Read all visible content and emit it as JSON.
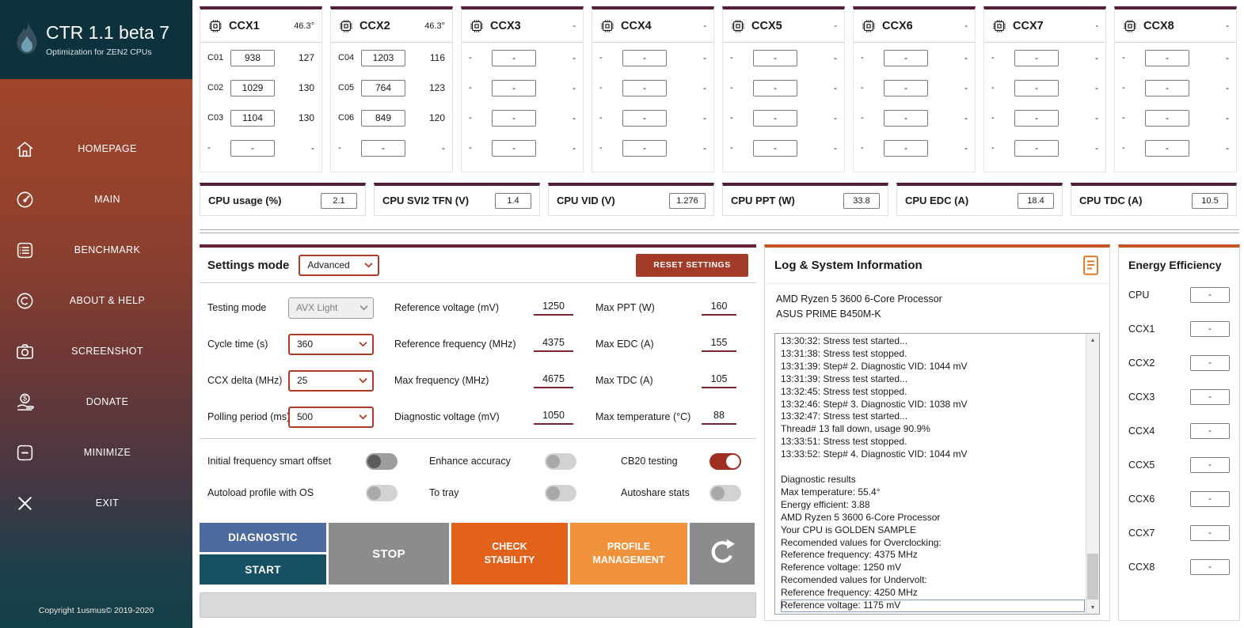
{
  "sidebar": {
    "title": "CTR 1.1 beta 7",
    "subtitle": "Optimization for ZEN2 CPUs",
    "items": [
      {
        "id": "homepage",
        "label": "HOMEPAGE",
        "icon": "home-icon"
      },
      {
        "id": "main",
        "label": "MAIN",
        "icon": "gauge-icon"
      },
      {
        "id": "benchmark",
        "label": "BENCHMARK",
        "icon": "benchmark-icon"
      },
      {
        "id": "about-help",
        "label": "ABOUT & HELP",
        "icon": "copyright-icon"
      },
      {
        "id": "screenshot",
        "label": "SCREENSHOT",
        "icon": "camera-icon"
      },
      {
        "id": "donate",
        "label": "DONATE",
        "icon": "donate-icon"
      },
      {
        "id": "minimize",
        "label": "MINIMIZE",
        "icon": "minimize-icon"
      },
      {
        "id": "exit",
        "label": "EXIT",
        "icon": "exit-icon"
      }
    ],
    "copyright": "Copyright 1usmus© 2019-2020"
  },
  "ccx_panels": [
    {
      "title": "CCX1",
      "temp": "46.3°",
      "rows": [
        {
          "core": "C01",
          "value": "938",
          "metric": "127"
        },
        {
          "core": "C02",
          "value": "1029",
          "metric": "130"
        },
        {
          "core": "C03",
          "value": "1104",
          "metric": "130"
        },
        {
          "core": "-",
          "value": "-",
          "metric": "-"
        }
      ]
    },
    {
      "title": "CCX2",
      "temp": "46.3°",
      "rows": [
        {
          "core": "C04",
          "value": "1203",
          "metric": "116"
        },
        {
          "core": "C05",
          "value": "764",
          "metric": "123"
        },
        {
          "core": "C06",
          "value": "849",
          "metric": "120"
        },
        {
          "core": "-",
          "value": "-",
          "metric": "-"
        }
      ]
    },
    {
      "title": "CCX3",
      "temp": "-",
      "rows": [
        {
          "core": "-",
          "value": "-",
          "metric": "-"
        },
        {
          "core": "-",
          "value": "-",
          "metric": "-"
        },
        {
          "core": "-",
          "value": "-",
          "metric": "-"
        },
        {
          "core": "-",
          "value": "-",
          "metric": "-"
        }
      ]
    },
    {
      "title": "CCX4",
      "temp": "-",
      "rows": [
        {
          "core": "-",
          "value": "-",
          "metric": "-"
        },
        {
          "core": "-",
          "value": "-",
          "metric": "-"
        },
        {
          "core": "-",
          "value": "-",
          "metric": "-"
        },
        {
          "core": "-",
          "value": "-",
          "metric": "-"
        }
      ]
    },
    {
      "title": "CCX5",
      "temp": "-",
      "rows": [
        {
          "core": "-",
          "value": "-",
          "metric": "-"
        },
        {
          "core": "-",
          "value": "-",
          "metric": "-"
        },
        {
          "core": "-",
          "value": "-",
          "metric": "-"
        },
        {
          "core": "-",
          "value": "-",
          "metric": "-"
        }
      ]
    },
    {
      "title": "CCX6",
      "temp": "-",
      "rows": [
        {
          "core": "-",
          "value": "-",
          "metric": "-"
        },
        {
          "core": "-",
          "value": "-",
          "metric": "-"
        },
        {
          "core": "-",
          "value": "-",
          "metric": "-"
        },
        {
          "core": "-",
          "value": "-",
          "metric": "-"
        }
      ]
    },
    {
      "title": "CCX7",
      "temp": "-",
      "rows": [
        {
          "core": "-",
          "value": "-",
          "metric": "-"
        },
        {
          "core": "-",
          "value": "-",
          "metric": "-"
        },
        {
          "core": "-",
          "value": "-",
          "metric": "-"
        },
        {
          "core": "-",
          "value": "-",
          "metric": "-"
        }
      ]
    },
    {
      "title": "CCX8",
      "temp": "-",
      "rows": [
        {
          "core": "-",
          "value": "-",
          "metric": "-"
        },
        {
          "core": "-",
          "value": "-",
          "metric": "-"
        },
        {
          "core": "-",
          "value": "-",
          "metric": "-"
        },
        {
          "core": "-",
          "value": "-",
          "metric": "-"
        }
      ]
    }
  ],
  "stats": [
    {
      "label": "CPU usage (%)",
      "value": "2.1"
    },
    {
      "label": "CPU SVI2 TFN (V)",
      "value": "1.4"
    },
    {
      "label": "CPU VID (V)",
      "value": "1.276"
    },
    {
      "label": "CPU PPT (W)",
      "value": "33.8"
    },
    {
      "label": "CPU EDC (A)",
      "value": "18.4"
    },
    {
      "label": "CPU TDC (A)",
      "value": "10.5"
    }
  ],
  "settings": {
    "header": {
      "label": "Settings mode",
      "value": "Advanced",
      "reset_label": "RESET SETTINGS"
    },
    "dropdown_rows": [
      {
        "label": "Testing mode",
        "value": "AVX Light",
        "disabled": true
      },
      {
        "label": "Cycle time (s)",
        "value": "360",
        "disabled": false
      },
      {
        "label": "CCX delta (MHz)",
        "value": "25",
        "disabled": false
      },
      {
        "label": "Polling period (ms)",
        "value": "500",
        "disabled": false
      }
    ],
    "value_rows_col2": [
      {
        "label": "Reference voltage (mV)",
        "value": "1250"
      },
      {
        "label": "Reference frequency (MHz)",
        "value": "4375"
      },
      {
        "label": "Max frequency (MHz)",
        "value": "4675"
      },
      {
        "label": "Diagnostic voltage (mV)",
        "value": "1050"
      }
    ],
    "value_rows_col3": [
      {
        "label": "Max PPT (W)",
        "value": "160"
      },
      {
        "label": "Max EDC (A)",
        "value": "155"
      },
      {
        "label": "Max TDC (A)",
        "value": "105"
      },
      {
        "label": "Max temperature (°C)",
        "value": "88"
      }
    ],
    "toggles": [
      {
        "label": "Initial frequency smart offset",
        "state": "off-dark"
      },
      {
        "label": "Enhance accuracy",
        "state": "off"
      },
      {
        "label": "CB20 testing",
        "state": "on"
      },
      {
        "label": "Autoload profile with OS",
        "state": "off"
      },
      {
        "label": "To tray",
        "state": "off"
      },
      {
        "label": "Autoshare stats",
        "state": "off"
      }
    ]
  },
  "actions": {
    "diagnostic": "DIAGNOSTIC",
    "start": "START",
    "stop": "STOP",
    "check_stability": "CHECK STABILITY",
    "profile_management": "PROFILE MANAGEMENT"
  },
  "log_panel": {
    "title": "Log & System Information",
    "cpu": "AMD Ryzen 5 3600 6-Core Processor",
    "motherboard": "ASUS PRIME B450M-K",
    "selected_line_index": 21,
    "lines": [
      "13:30:32: Stress test started...",
      "13:31:38: Stress test stopped.",
      "13:31:39: Step# 2. Diagnostic VID: 1044 mV",
      "13:31:39: Stress test started...",
      "13:32:45: Stress test stopped.",
      "13:32:46: Step# 3. Diagnostic VID: 1038 mV",
      "13:32:47: Stress test started...",
      "Thread# 13 fall down, usage 90.9%",
      "13:33:51: Stress test stopped.",
      "13:33:52: Step# 4. Diagnostic VID: 1044 mV",
      "",
      "Diagnostic results",
      "Max temperature: 55.4°",
      "Energy efficient: 3.88",
      "AMD Ryzen 5 3600 6-Core Processor",
      "Your CPU is GOLDEN SAMPLE",
      "Recomended values for Overclocking:",
      "Reference frequency: 4375 MHz",
      "Reference voltage: 1250 mV",
      "Recomended values for Undervolt:",
      "Reference frequency: 4250 MHz",
      "Reference voltage: 1175 mV"
    ]
  },
  "energy": {
    "title": "Energy Efficiency",
    "rows": [
      {
        "label": "CPU",
        "value": "-"
      },
      {
        "label": "CCX1",
        "value": "-"
      },
      {
        "label": "CCX2",
        "value": "-"
      },
      {
        "label": "CCX3",
        "value": "-"
      },
      {
        "label": "CCX4",
        "value": "-"
      },
      {
        "label": "CCX5",
        "value": "-"
      },
      {
        "label": "CCX6",
        "value": "-"
      },
      {
        "label": "CCX7",
        "value": "-"
      },
      {
        "label": "CCX8",
        "value": "-"
      }
    ]
  },
  "colors": {
    "maroon_bar": "#511e3b",
    "orange_bar": "#c8551e",
    "red_accent": "#ad3b27",
    "reset_red": "#a23b28",
    "diagnostic_blue": "#4d6b9e",
    "start_teal": "#175062",
    "stop_gray": "#8c8c8c",
    "check_orange": "#e2611b",
    "profile_orange": "#f0913b",
    "toggle_on_red": "#9e2d22",
    "sidebar_top": "#0e323d"
  }
}
